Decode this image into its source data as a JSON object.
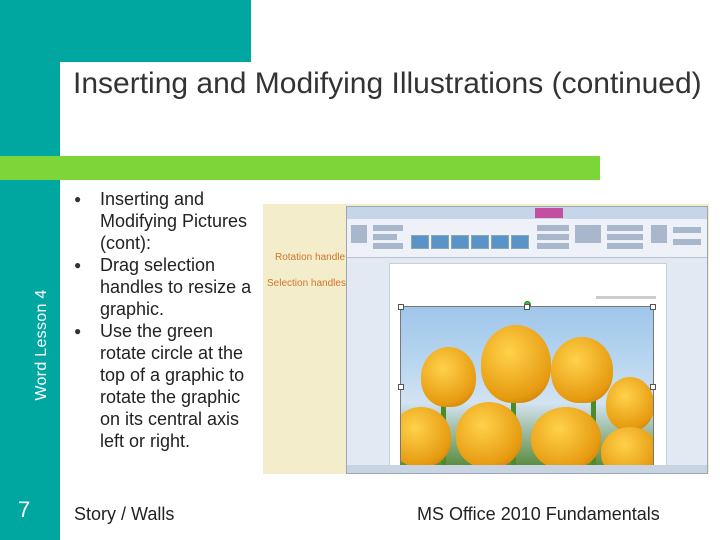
{
  "slide": {
    "title": "Inserting and Modifying Illustrations (continued)",
    "side_label": "Word Lesson 4",
    "slide_number": "7",
    "bullets": [
      "Inserting and Modifying Pictures (cont):",
      "Drag selection handles to resize a graphic.",
      "Use the green rotate circle at the top of a graphic to rotate the graphic on its central axis left or right."
    ],
    "footer_left": "Story / Walls",
    "footer_right": "MS Office 2010 Fundamentals"
  },
  "screenshot": {
    "callouts": [
      "Rotation handle",
      "Selection handles"
    ]
  },
  "colors": {
    "teal": "#00a6a0",
    "green": "#7cd63a",
    "callout": "#d0752a"
  }
}
